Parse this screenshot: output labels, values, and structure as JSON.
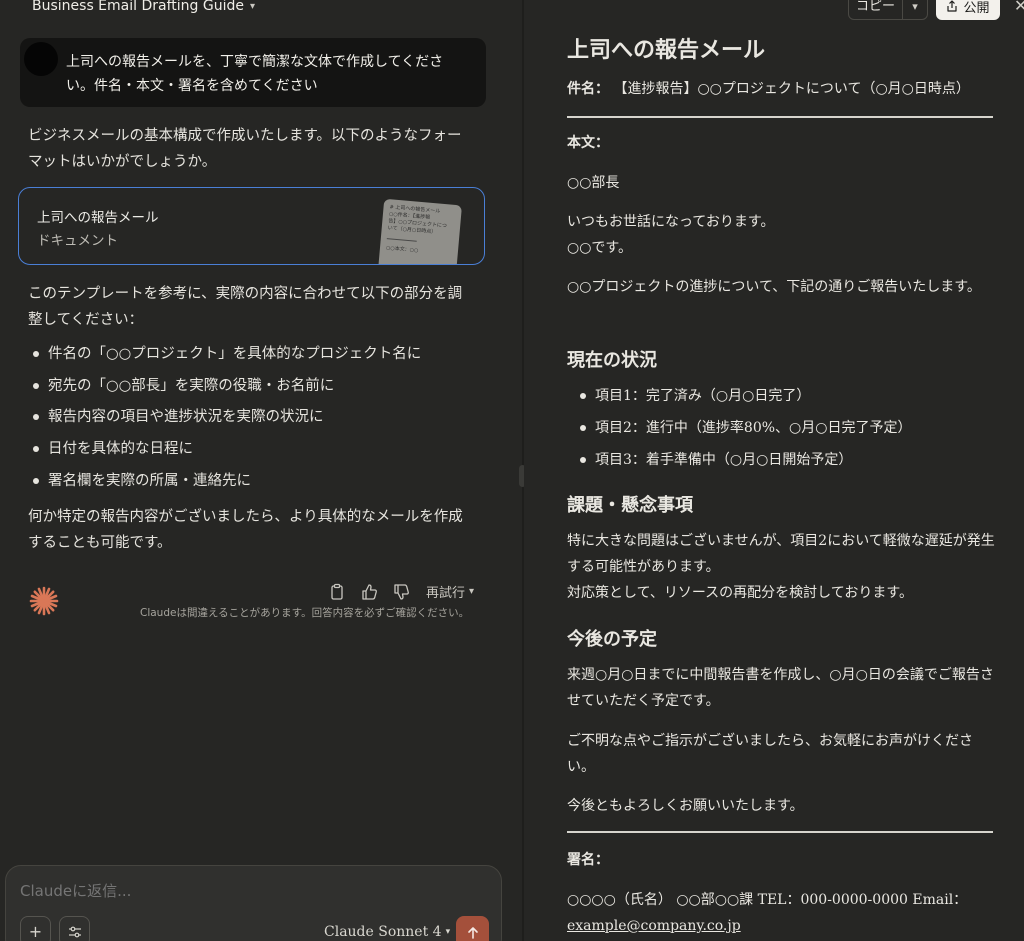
{
  "header": {
    "project_title": "Business Email Drafting Guide"
  },
  "user_message": {
    "text": "上司への報告メールを、丁寧で簡潔な文体で作成してください。件名・本文・署名を含めてください"
  },
  "assistant": {
    "intro": "ビジネスメールの基本構成で作成いたします。以下のようなフォーマットはいかがでしょうか。",
    "artifact": {
      "title": "上司への報告メール",
      "type_label": "ドキュメント",
      "thumb_lines": [
        "# 上司への報告メール",
        "○○件名：【進捗報",
        "告】○○プロジェクトにつ",
        "いて（○月○日時点）",
        "○○本文：○○"
      ]
    },
    "adjust_text": "このテンプレートを参考に、実際の内容に合わせて以下の部分を調整してください：",
    "adjust_items": [
      "件名の「○○プロジェクト」を具体的なプロジェクト名に",
      "宛先の「○○部長」を実際の役職・お名前に",
      "報告内容の項目や進捗状況を実際の状況に",
      "日付を具体的な日程に",
      "署名欄を実際の所属・連絡先に"
    ],
    "closing": "何か特定の報告内容がございましたら、より具体的なメールを作成することも可能です。",
    "retry_label": "再試行",
    "disclaimer": "Claudeは間違えることがあります。回答内容を必ずご確認ください。"
  },
  "composer": {
    "placeholder": "Claudeに返信...",
    "model": "Claude Sonnet 4"
  },
  "artifact_panel": {
    "copy_label": "コピー",
    "publish_label": "公開",
    "title": "上司への報告メール",
    "subject_label": "件名：",
    "subject_value": "【進捗報告】○○プロジェクトについて（○月○日時点）",
    "body_label": "本文：",
    "addressee": "○○部長",
    "greeting_1": "いつもお世話になっております。",
    "greeting_2": "○○です。",
    "intro": "○○プロジェクトの進捗について、下記の通りご報告いたします。",
    "status_heading": "現在の状況",
    "status_items": [
      "項目1：完了済み（○月○日完了）",
      "項目2：進行中（進捗率80%、○月○日完了予定）",
      "項目3：着手準備中（○月○日開始予定）"
    ],
    "issues_heading": "課題・懸念事項",
    "issues_text_1": "特に大きな問題はございませんが、項目2において軽微な遅延が発生する可能性があります。",
    "issues_text_2": "対応策として、リソースの再配分を検討しております。",
    "plan_heading": "今後の予定",
    "plan_text": "来週○月○日までに中間報告書を作成し、○月○日の会議でご報告させていただく予定です。",
    "closing_1": "ご不明な点やご指示がございましたら、お気軽にお声がけください。",
    "closing_2": "今後ともよろしくお願いいたします。",
    "signature_label": "署名：",
    "signature_text": "○○○○（氏名） ○○部○○課 TEL：000-0000-0000 Email：",
    "signature_email": "example@company.co.jp"
  },
  "colors": {
    "accent": "#4a7fd6",
    "send": "#a4503b",
    "claude_logo": "#d97757"
  }
}
